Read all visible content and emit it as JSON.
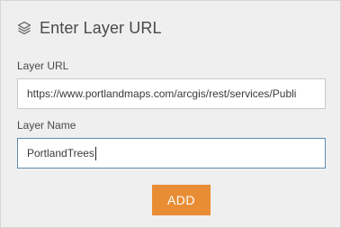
{
  "header": {
    "icon": "layers-icon",
    "title": "Enter Layer URL"
  },
  "form": {
    "url_label": "Layer URL",
    "url_value": "https://www.portlandmaps.com/arcgis/rest/services/Publi",
    "name_label": "Layer Name",
    "name_value": "PortlandTrees"
  },
  "actions": {
    "add_label": "ADD"
  },
  "colors": {
    "accent": "#e98d35",
    "focus_border": "#5f8cb0",
    "panel_bg": "#efefef"
  }
}
